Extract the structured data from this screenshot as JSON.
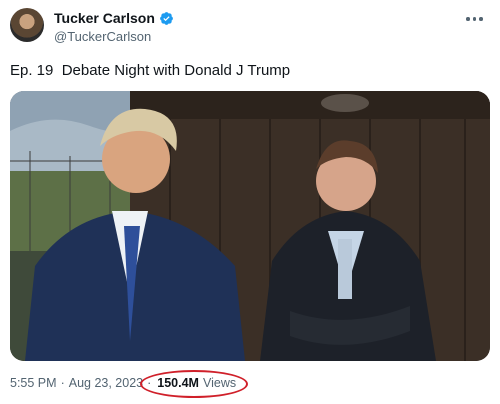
{
  "author": {
    "display_name": "Tucker Carlson",
    "handle": "@TuckerCarlson",
    "verified": true
  },
  "tweet": {
    "text": "Ep. 19  Debate Night with Donald J Trump"
  },
  "meta": {
    "time": "5:55 PM",
    "date": "Aug 23, 2023",
    "separator": "·",
    "views_count": "150.4M",
    "views_label": "Views"
  },
  "icons": {
    "verified": "verified-badge-icon",
    "more": "more-options-icon"
  },
  "colors": {
    "verified_blue": "#1d9bf0",
    "highlight_red": "#d0202a",
    "secondary_text": "#536471"
  }
}
